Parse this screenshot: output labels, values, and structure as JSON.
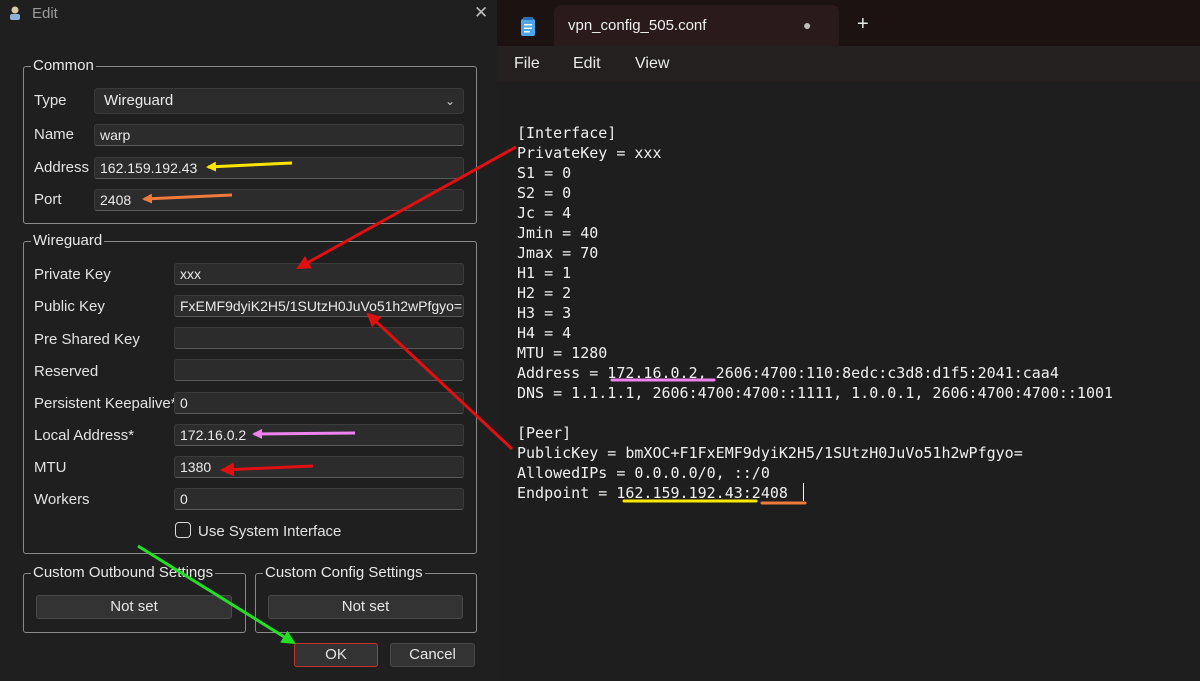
{
  "dialog": {
    "title": "Edit",
    "common": {
      "group_label": "Common",
      "type_label": "Type",
      "type_value": "Wireguard",
      "name_label": "Name",
      "name_value": "warp",
      "address_label": "Address",
      "address_value": "162.159.192.43",
      "port_label": "Port",
      "port_value": "2408"
    },
    "wireguard": {
      "group_label": "Wireguard",
      "private_key_label": "Private Key",
      "private_key_value": "xxx",
      "public_key_label": "Public Key",
      "public_key_value": "FxEMF9dyiK2H5/1SUtzH0JuVo51h2wPfgyo=",
      "pre_shared_key_label": "Pre Shared Key",
      "pre_shared_key_value": "",
      "reserved_label": "Reserved",
      "reserved_value": "",
      "keepalive_label": "Persistent Keepalive*",
      "keepalive_value": "0",
      "local_address_label": "Local Address*",
      "local_address_value": "172.16.0.2",
      "mtu_label": "MTU",
      "mtu_value": "1380",
      "workers_label": "Workers",
      "workers_value": "0",
      "use_system_interface_label": "Use System Interface",
      "use_system_interface_checked": false
    },
    "custom_outbound": {
      "group_label": "Custom Outbound Settings",
      "button_label": "Not set"
    },
    "custom_config": {
      "group_label": "Custom Config Settings",
      "button_label": "Not set"
    },
    "ok_label": "OK",
    "cancel_label": "Cancel"
  },
  "notepad": {
    "tab_title": "vpn_config_505.conf",
    "plus": "+",
    "menu": [
      "File",
      "Edit",
      "View"
    ],
    "lines": [
      "[Interface]",
      "PrivateKey = xxx",
      "S1 = 0",
      "S2 = 0",
      "Jc = 4",
      "Jmin = 40",
      "Jmax = 70",
      "H1 = 1",
      "H2 = 2",
      "H3 = 3",
      "H4 = 4",
      "MTU = 1280",
      "Address = 172.16.0.2, 2606:4700:110:8edc:c3d8:d1f5:2041:caa4",
      "DNS = 1.1.1.1, 2606:4700:4700::1111, 1.0.0.1, 2606:4700:4700::1001",
      "",
      "[Peer]",
      "PublicKey = bmXOC+F1FxEMF9dyiK2H5/1SUtzH0JuVo51h2wPfgyo=",
      "AllowedIPs = 0.0.0.0/0, ::/0",
      "Endpoint = 162.159.192.43:2408"
    ]
  },
  "colors": {
    "yellow_arrow": "#ffe600",
    "orange_arrow": "#f07a3c",
    "red_arrow": "#e01010",
    "pink_arrow": "#ee82ee",
    "green_arrow": "#22e022",
    "ok_border": "#c83232"
  }
}
